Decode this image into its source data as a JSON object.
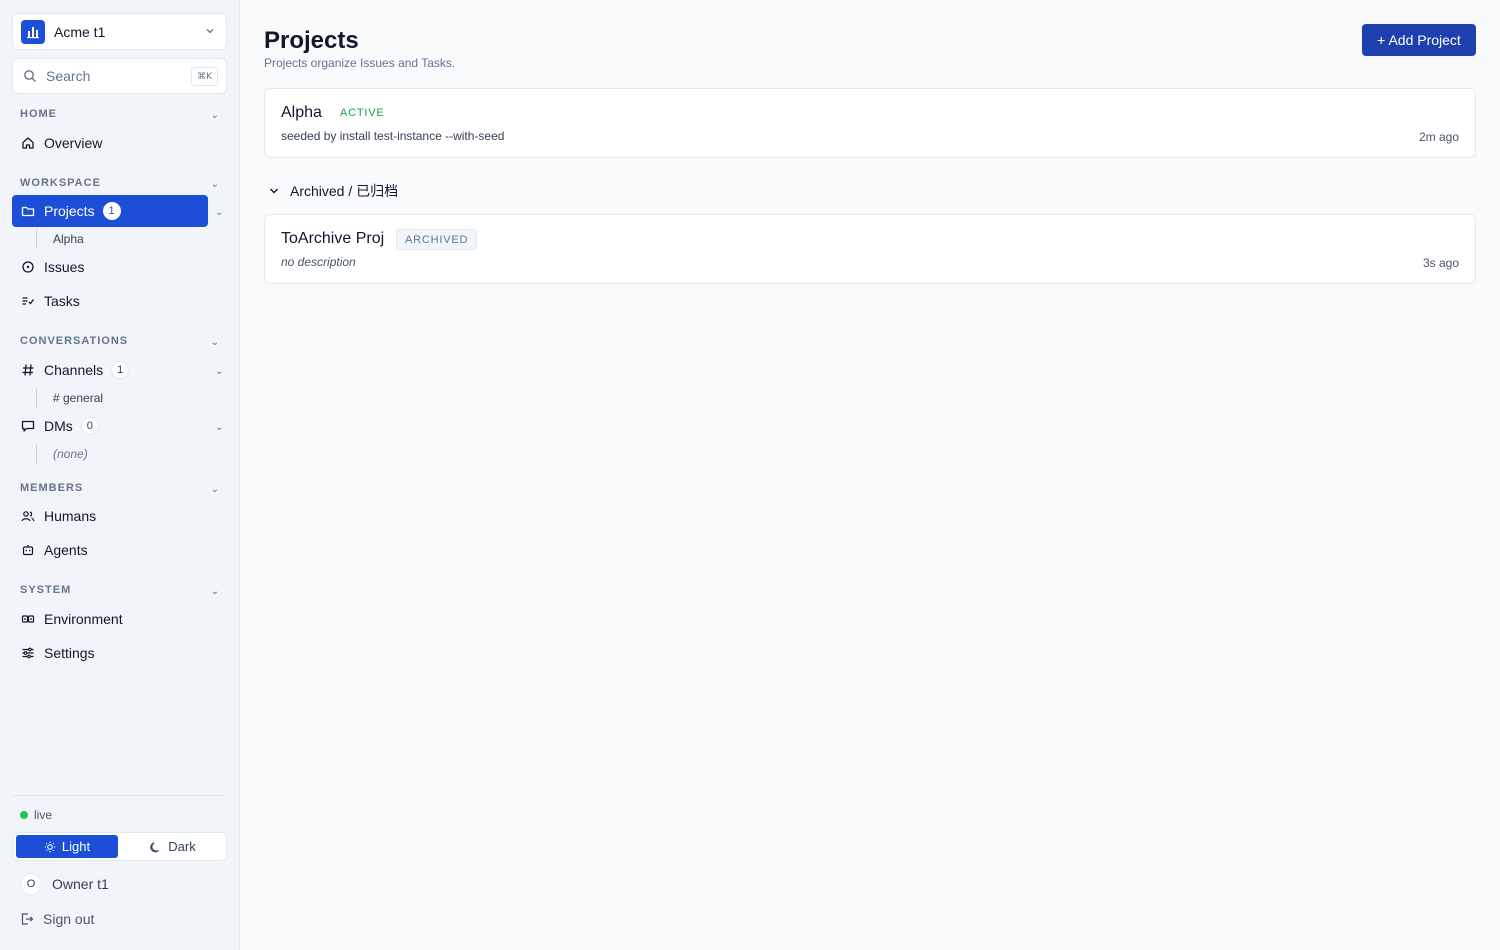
{
  "sidebar": {
    "workspace": {
      "name": "Acme t1"
    },
    "search": {
      "placeholder": "Search",
      "shortcut": "⌘K"
    },
    "sections": {
      "home": "HOME",
      "workspace": "WORKSPACE",
      "conversations": "CONVERSATIONS",
      "members": "MEMBERS",
      "system": "SYSTEM"
    },
    "items": {
      "overview": "Overview",
      "projects": "Projects",
      "projects_count": "1",
      "projects_sub": "Alpha",
      "issues": "Issues",
      "tasks": "Tasks",
      "channels": "Channels",
      "channels_count": "1",
      "channels_sub": "# general",
      "dms": "DMs",
      "dms_count": "0",
      "dms_sub": "(none)",
      "humans": "Humans",
      "agents": "Agents",
      "environment": "Environment",
      "settings": "Settings"
    },
    "footer": {
      "status": "live",
      "theme_light": "Light",
      "theme_dark": "Dark",
      "owner_initial": "O",
      "owner_name": "Owner t1",
      "sign_out": "Sign out"
    }
  },
  "main": {
    "title": "Projects",
    "subtitle": "Projects organize Issues and Tasks.",
    "add_button": "+ Add Project",
    "projects": [
      {
        "name": "Alpha",
        "status": "ACTIVE",
        "description": "seeded by install test-instance --with-seed",
        "time": "2m ago"
      }
    ],
    "archived_label": "Archived / 已归档",
    "archived": [
      {
        "name": "ToArchive Proj",
        "status": "ARCHIVED",
        "description": "no description",
        "time": "3s ago"
      }
    ]
  },
  "colors": {
    "accent": "#1d4ed8",
    "active_status": "#16a34a",
    "live": "#22c55e"
  }
}
